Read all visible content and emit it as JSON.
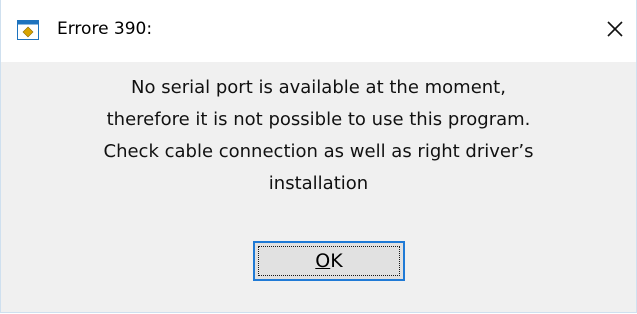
{
  "window": {
    "title": "Errore 390:",
    "icon": "app-window-icon",
    "close_icon": "close-icon",
    "close_glyph": "✕"
  },
  "dialog": {
    "message_lines": [
      "No serial port is available at the moment,",
      "therefore it is not possible to use this program.",
      "Check cable connection as well as right driver’s",
      "installation"
    ],
    "ok_button": {
      "mnemonic": "O",
      "rest": "K"
    }
  },
  "colors": {
    "dialog_background": "#f0f0f0",
    "titlebar_background": "#ffffff",
    "focus_border": "#1f7ad6",
    "icon_accent": "#1e73be",
    "icon_diamond": "#d9a400"
  }
}
